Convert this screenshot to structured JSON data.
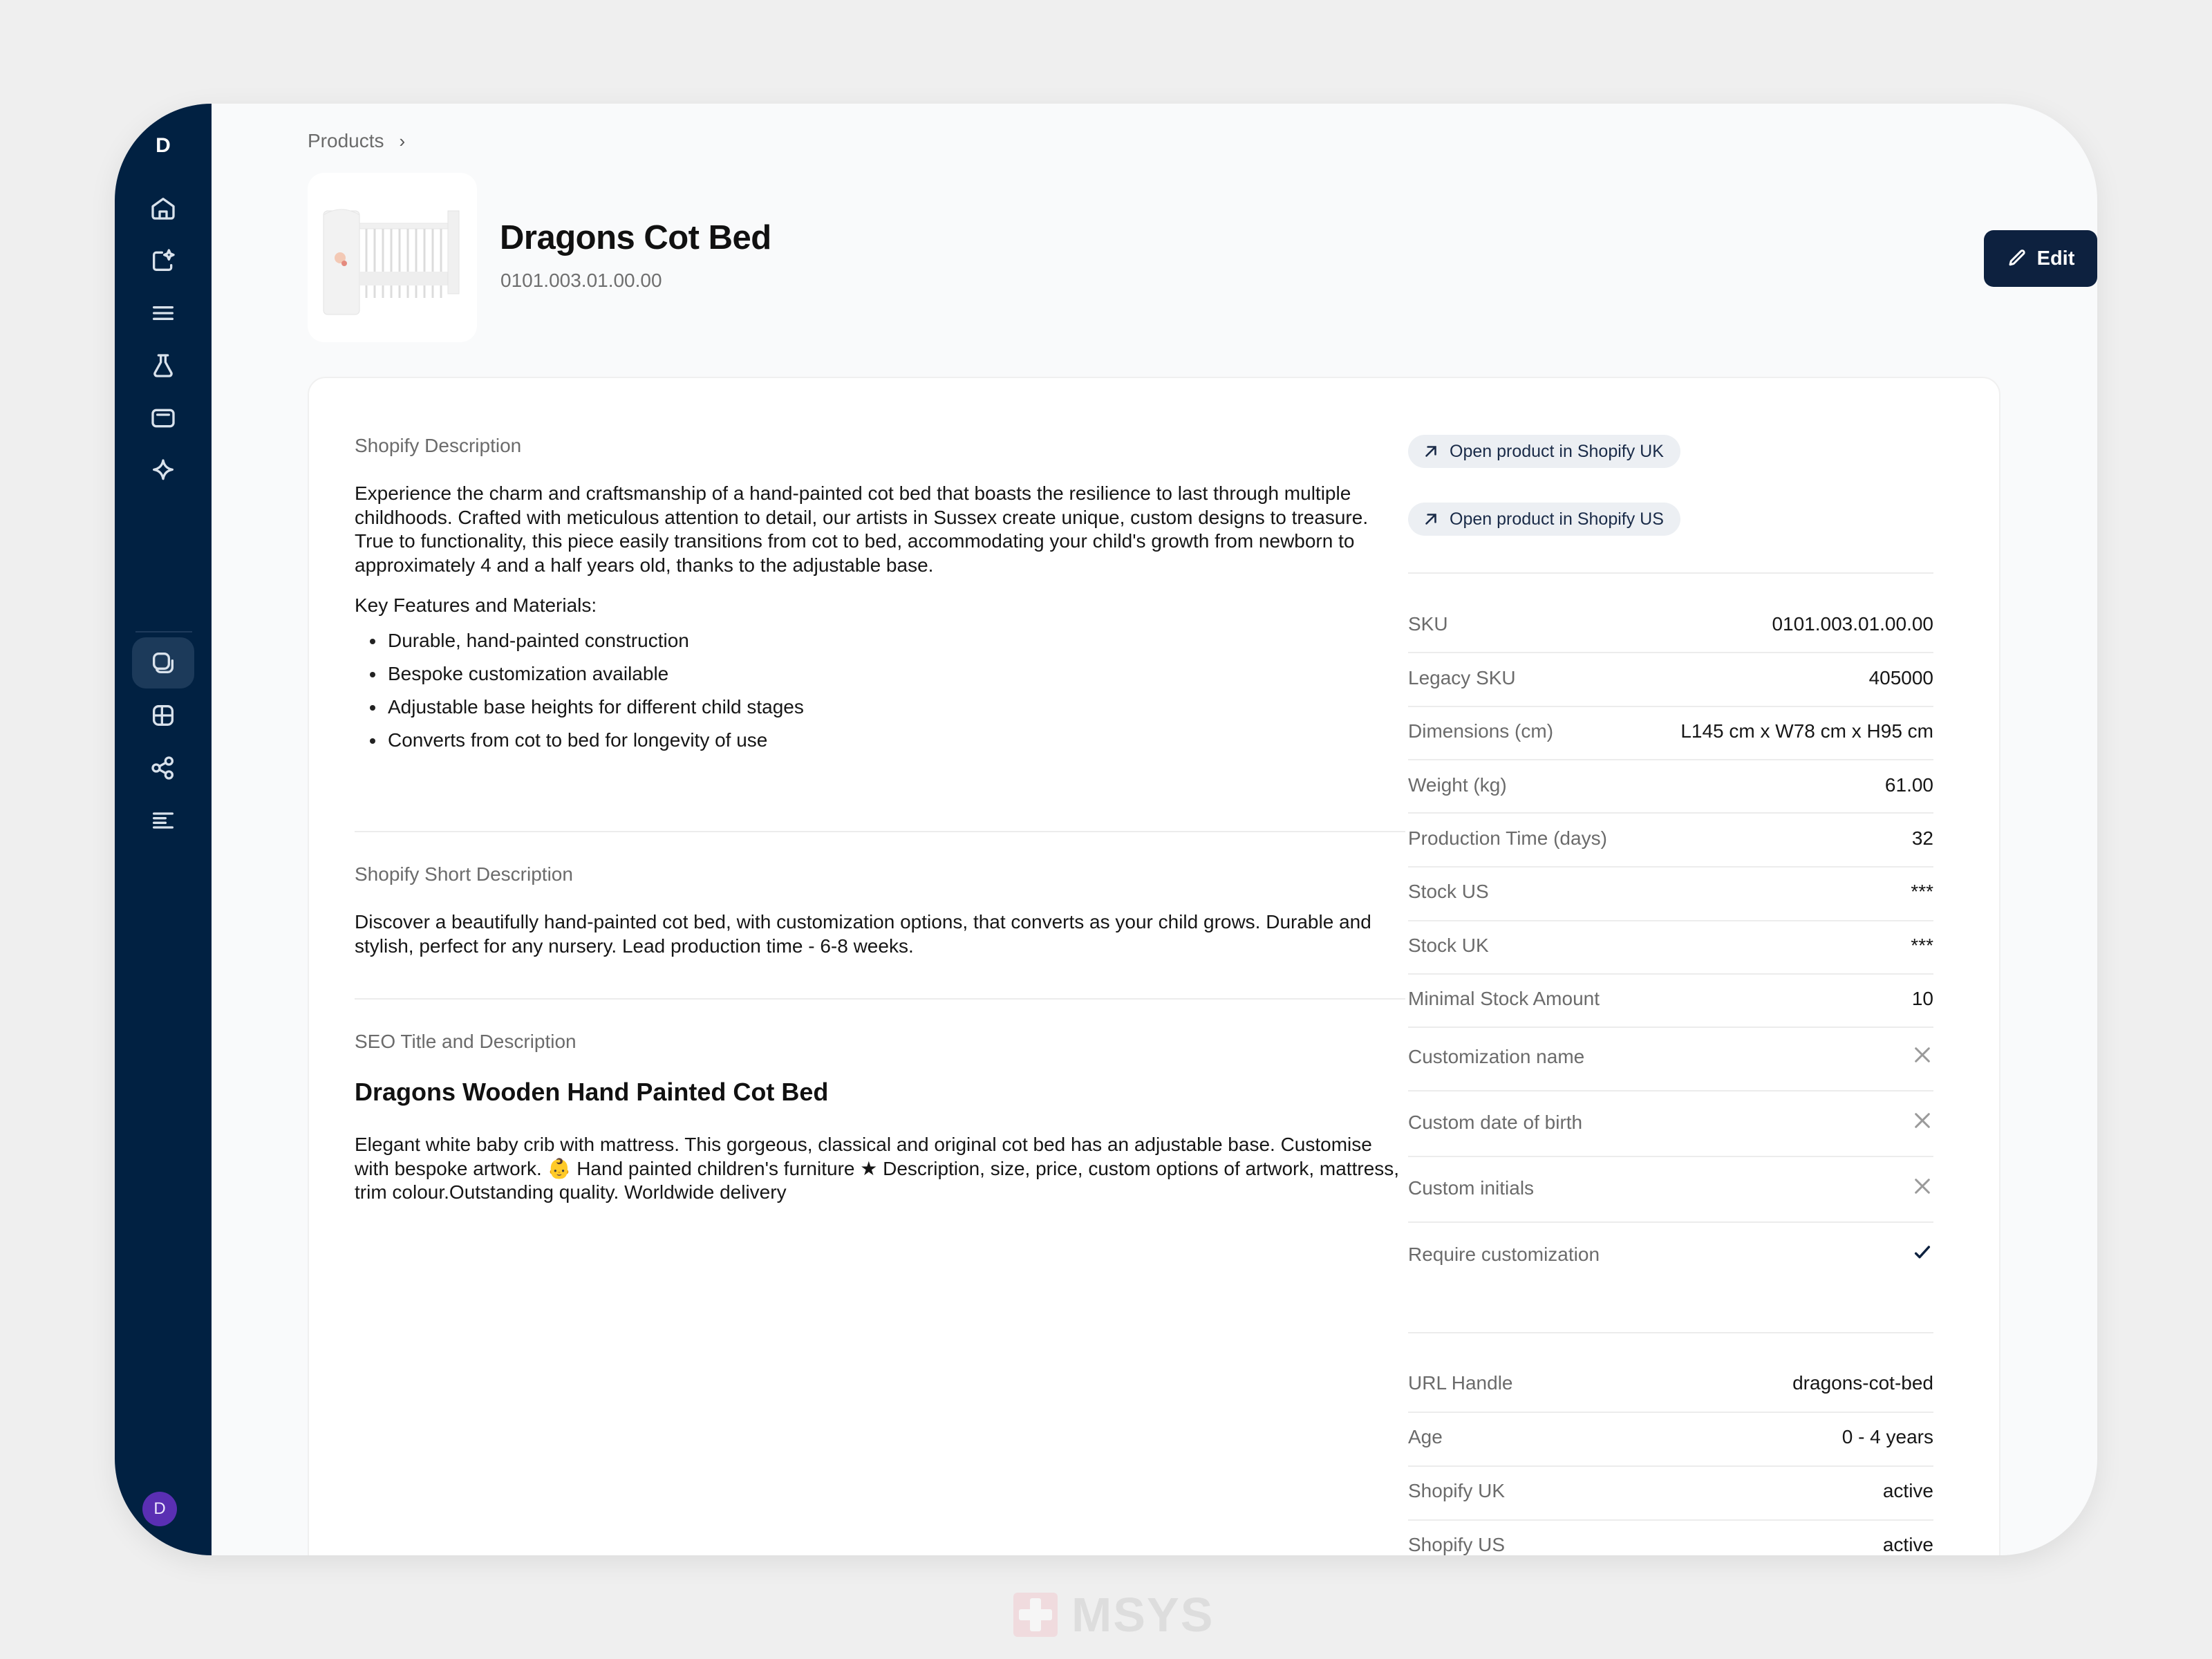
{
  "sidebar": {
    "logo": "D",
    "items": [
      {
        "name": "home",
        "icon": "home-icon"
      },
      {
        "name": "ai-import",
        "icon": "sparkle-folder-icon"
      },
      {
        "name": "menu",
        "icon": "menu-icon"
      },
      {
        "name": "lab",
        "icon": "flask-icon"
      },
      {
        "name": "payments",
        "icon": "card-icon"
      },
      {
        "name": "ai",
        "icon": "sparkle-icon"
      },
      {
        "name": "products",
        "icon": "layers-icon",
        "active": true
      },
      {
        "name": "grid",
        "icon": "grid-icon"
      },
      {
        "name": "share",
        "icon": "share-icon"
      },
      {
        "name": "text",
        "icon": "align-left-icon"
      }
    ],
    "avatar": "D"
  },
  "breadcrumb": {
    "items": [
      "Products"
    ]
  },
  "product": {
    "title": "Dragons Cot Bed",
    "sku": "0101.003.01.00.00",
    "image_alt": "white hand-painted cot bed"
  },
  "toolbar": {
    "edit_label": "Edit"
  },
  "description": {
    "label": "Shopify Description",
    "body": "Experience the charm and craftsmanship of a hand-painted cot bed that boasts the resilience to last through multiple childhoods. Crafted with meticulous attention to detail, our artists in Sussex create unique, custom de­signs to treasure. True to functionality, this piece easily transitions from cot to bed, accommodating your child's growth from newborn to approximately 4 and a half years old, thanks to the adjustable base.",
    "features_label": "Key Features and Materials:",
    "features": [
      "Durable, hand-painted construction",
      "Bespoke customization available",
      "Adjustable base heights for different child stages",
      "Converts from cot to bed for longevity of use"
    ]
  },
  "short_description": {
    "label": "Shopify Short Description",
    "body": "Discover a beautifully hand-painted cot bed, with customization options, that converts as your child grows. Durable and stylish, perfect for any nursery. Lead production time - 6-8 weeks."
  },
  "seo": {
    "label": "SEO Title and Description",
    "title": "Dragons Wooden Hand Painted Cot Bed",
    "body": "Elegant white baby crib with mattress. This gorgeous, classical and original cot bed has an adjustable base. Customise with bespoke artwork. 👶 Hand painted children's furniture ★ Description, size, price, custom op­tions of artwork, mattress, trim colour.Outstanding quality. Worldwide delivery"
  },
  "links": [
    {
      "label": "Open product in Shopify UK"
    },
    {
      "label": "Open product in Shopify US"
    }
  ],
  "properties": [
    {
      "key": "SKU",
      "value": "0101.003.01.00.00"
    },
    {
      "key": "Legacy SKU",
      "value": "405000"
    },
    {
      "key": "Dimensions (cm)",
      "value": "L145 cm x W78 cm x H95 cm"
    },
    {
      "key": "Weight (kg)",
      "value": "61.00"
    },
    {
      "key": "Production Time (days)",
      "value": "32"
    },
    {
      "key": "Stock US",
      "value": "***"
    },
    {
      "key": "Stock UK",
      "value": "***"
    },
    {
      "key": "Minimal Stock Amount",
      "value": "10"
    }
  ],
  "customization": [
    {
      "key": "Customization name",
      "value": false
    },
    {
      "key": "Custom date of birth",
      "value": false
    },
    {
      "key": "Custom initials",
      "value": false
    },
    {
      "key": "Require customization",
      "value": true
    }
  ],
  "shop_properties": [
    {
      "key": "URL Handle",
      "value": "dragons-cot-bed"
    },
    {
      "key": "Age",
      "value": "0 - 4 years"
    },
    {
      "key": "Shopify UK",
      "value": "active"
    },
    {
      "key": "Shopify US",
      "value": "active"
    }
  ],
  "watermark": {
    "text": "MSYS"
  },
  "colors": {
    "sidebar_bg": "#012142",
    "primary_button": "#0d213f",
    "avatar": "#5a2fb3",
    "pill_bg": "#eceff3"
  }
}
